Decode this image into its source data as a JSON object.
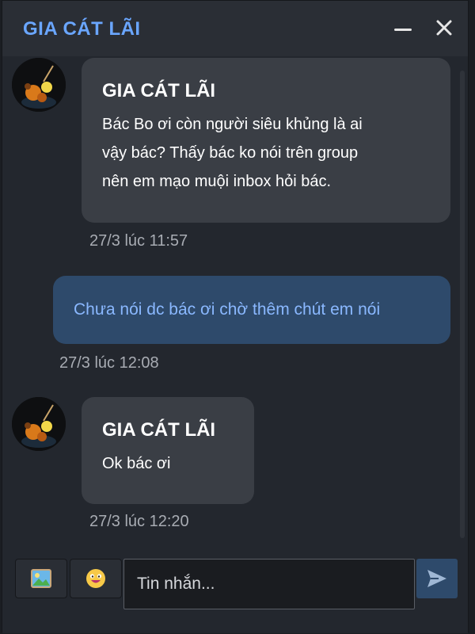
{
  "header": {
    "title": "GIA CÁT LÃI",
    "minimize_icon": "minimize-icon",
    "close_icon": "close-icon"
  },
  "messages": [
    {
      "direction": "incoming",
      "sender": "GIA CÁT LÃI",
      "lines": [
        "Bác Bo ơi còn người siêu khủng là ai",
        "vậy bác? Thấy bác ko nói trên group",
        "nên em mạo muội inbox hỏi bác."
      ],
      "time": "27/3 lúc 11:57"
    },
    {
      "direction": "outgoing",
      "text": "Chưa nói dc bác ơi chờ thêm chút em nói",
      "time": "27/3 lúc 12:08"
    },
    {
      "direction": "incoming",
      "sender": "GIA CÁT LÃI",
      "lines": [
        "Ok bác ơi"
      ],
      "time": "27/3 lúc 12:20"
    }
  ],
  "composer": {
    "placeholder": "Tin nhắn...",
    "image_icon": "image-icon",
    "emoji_icon": "emoji-icon",
    "send_icon": "send-icon"
  },
  "colors": {
    "accent": "#6aa6ff",
    "outgoing_bubble": "#2e4a6b",
    "incoming_bubble": "#3a3e45"
  }
}
